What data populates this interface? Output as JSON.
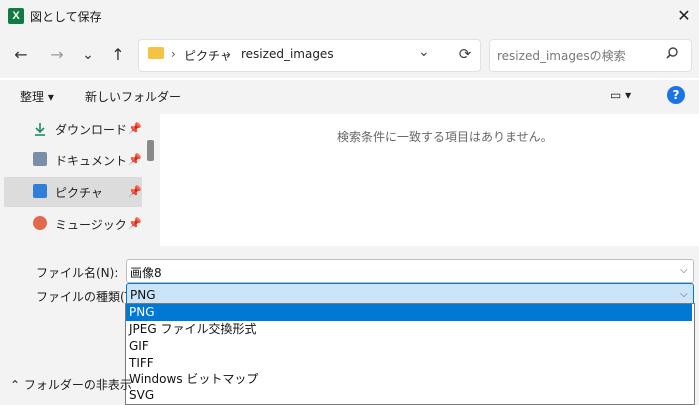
{
  "window": {
    "title": "図として保存",
    "app_icon": "X"
  },
  "nav": {
    "back": "←",
    "forward": "→",
    "recent": "⌄",
    "up": "↑",
    "breadcrumb": [
      "ピクチャ",
      "resized_images"
    ],
    "sep": "›",
    "dropdown": "⌄",
    "refresh": "⟳",
    "search_placeholder": "resized_imagesの検索"
  },
  "toolbar": {
    "organize": "整理 ▾",
    "new_folder": "新しいフォルダー",
    "view": "▭ ▾",
    "help": "?"
  },
  "sidebar": {
    "items": [
      {
        "label": "ダウンロード",
        "pin": "📌"
      },
      {
        "label": "ドキュメント",
        "pin": "📌"
      },
      {
        "label": "ピクチャ",
        "pin": "📌"
      },
      {
        "label": "ミュージック",
        "pin": "📌"
      }
    ]
  },
  "content": {
    "empty_message": "検索条件に一致する項目はありません。"
  },
  "form": {
    "filename_label": "ファイル名(N):",
    "filename_value": "画像8",
    "filetype_label": "ファイルの種類(T):",
    "filetype_value": "PNG",
    "filetype_options": [
      "PNG",
      "JPEG ファイル交換形式",
      "GIF",
      "TIFF",
      "Windows ビットマップ",
      "SVG"
    ]
  },
  "footer": {
    "hide_folders": "フォルダーの非表示"
  },
  "colors": {
    "accent": "#0078d4",
    "excel": "#107c41"
  }
}
